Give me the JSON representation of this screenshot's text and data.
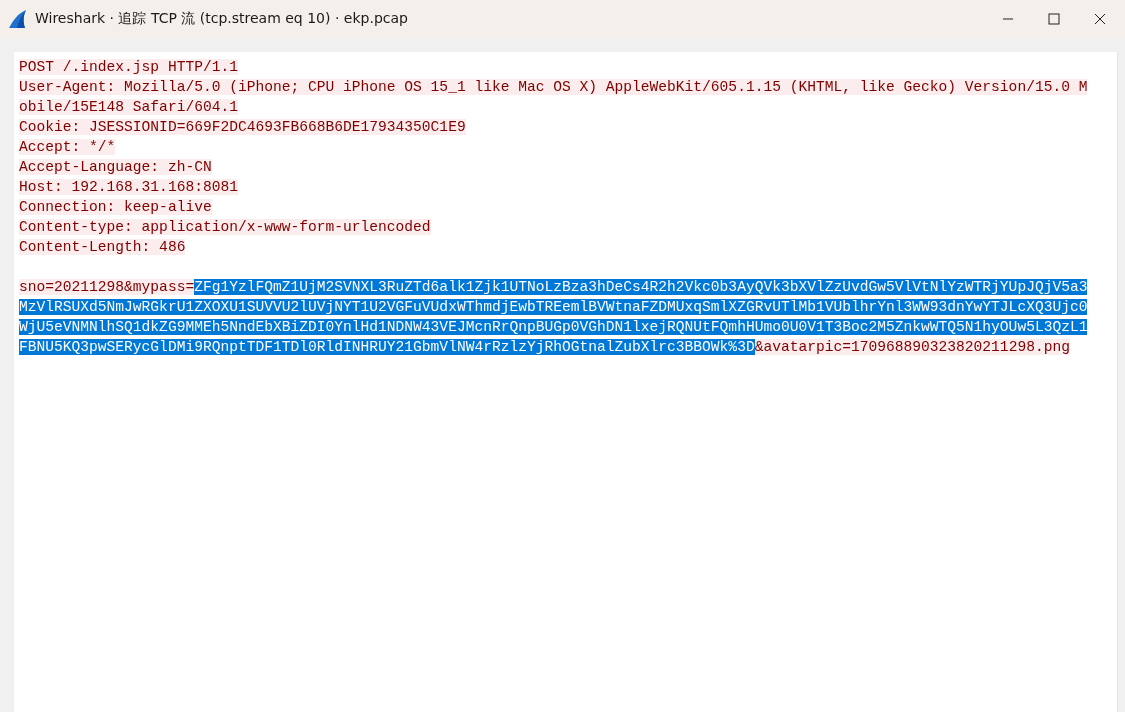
{
  "window": {
    "title": "Wireshark · 追踪 TCP 流 (tcp.stream eq 10) · ekp.pcap"
  },
  "stream": {
    "lines": [
      {
        "kind": "text",
        "segments": [
          {
            "text": "POST /.index.jsp HTTP/1.1",
            "selected": false
          }
        ]
      },
      {
        "kind": "text",
        "segments": [
          {
            "text": "User-Agent: Mozilla/5.0 (iPhone; CPU iPhone OS 15_1 like Mac OS X) AppleWebKit/605.1.15 (KHTML, like Gecko) Version/15.0 M",
            "selected": false
          }
        ]
      },
      {
        "kind": "text",
        "segments": [
          {
            "text": "obile/15E148 Safari/604.1",
            "selected": false
          }
        ]
      },
      {
        "kind": "text",
        "segments": [
          {
            "text": "Cookie: JSESSIONID=669F2DC4693FB668B6DE17934350C1E9",
            "selected": false
          }
        ]
      },
      {
        "kind": "text",
        "segments": [
          {
            "text": "Accept: */*",
            "selected": false
          }
        ]
      },
      {
        "kind": "text",
        "segments": [
          {
            "text": "Accept-Language: zh-CN",
            "selected": false
          }
        ]
      },
      {
        "kind": "text",
        "segments": [
          {
            "text": "Host: 192.168.31.168:8081",
            "selected": false
          }
        ]
      },
      {
        "kind": "text",
        "segments": [
          {
            "text": "Connection: keep-alive",
            "selected": false
          }
        ]
      },
      {
        "kind": "text",
        "segments": [
          {
            "text": "Content-type: application/x-www-form-urlencoded",
            "selected": false
          }
        ]
      },
      {
        "kind": "text",
        "segments": [
          {
            "text": "Content-Length: 486",
            "selected": false
          }
        ]
      },
      {
        "kind": "blank"
      },
      {
        "kind": "text",
        "segments": [
          {
            "text": "sno=20211298&mypass=",
            "selected": false
          },
          {
            "text": "ZFg1YzlFQmZ1UjM2SVNXL3RuZTd6alk1Zjk1UTNoLzBza3hDeCs4R2h2Vkc0b3AyQVk3bXVlZzUvdGw5VlVtNlYzWTRjYUpJQjV5a3",
            "selected": true
          }
        ]
      },
      {
        "kind": "text",
        "segments": [
          {
            "text": "MzVlRSUXd5NmJwRGkrU1ZXOXU1SUVVU2lUVjNYT1U2VGFuVUdxWThmdjEwbTREemlBVWtnaFZDMUxqSmlXZGRvUTlMb1VUblhrYnl3WW93dnYwYTJLcXQ3Ujc0",
            "selected": true
          }
        ]
      },
      {
        "kind": "text",
        "segments": [
          {
            "text": "WjU5eVNMNlhSQ1dkZG9MMEh5NndEbXBiZDI0YnlHd1NDNW43VEJMcnRrQnpBUGp0VGhDN1lxejRQNUtFQmhHUmo0U0V1T3Boc2M5ZnkwWTQ5N1hyOUw5L3QzL1",
            "selected": true
          }
        ]
      },
      {
        "kind": "text",
        "segments": [
          {
            "text": "FBNU5KQ3pwSERycGlDMi9RQnptTDF1TDl0RldINHRUY21GbmVlNW4rRzlzYjRhOGtnalZubXlrc3BBOWk%3D",
            "selected": true
          },
          {
            "text": "&avatarpic=170968890323820211298.png",
            "selected": false
          }
        ]
      }
    ]
  }
}
